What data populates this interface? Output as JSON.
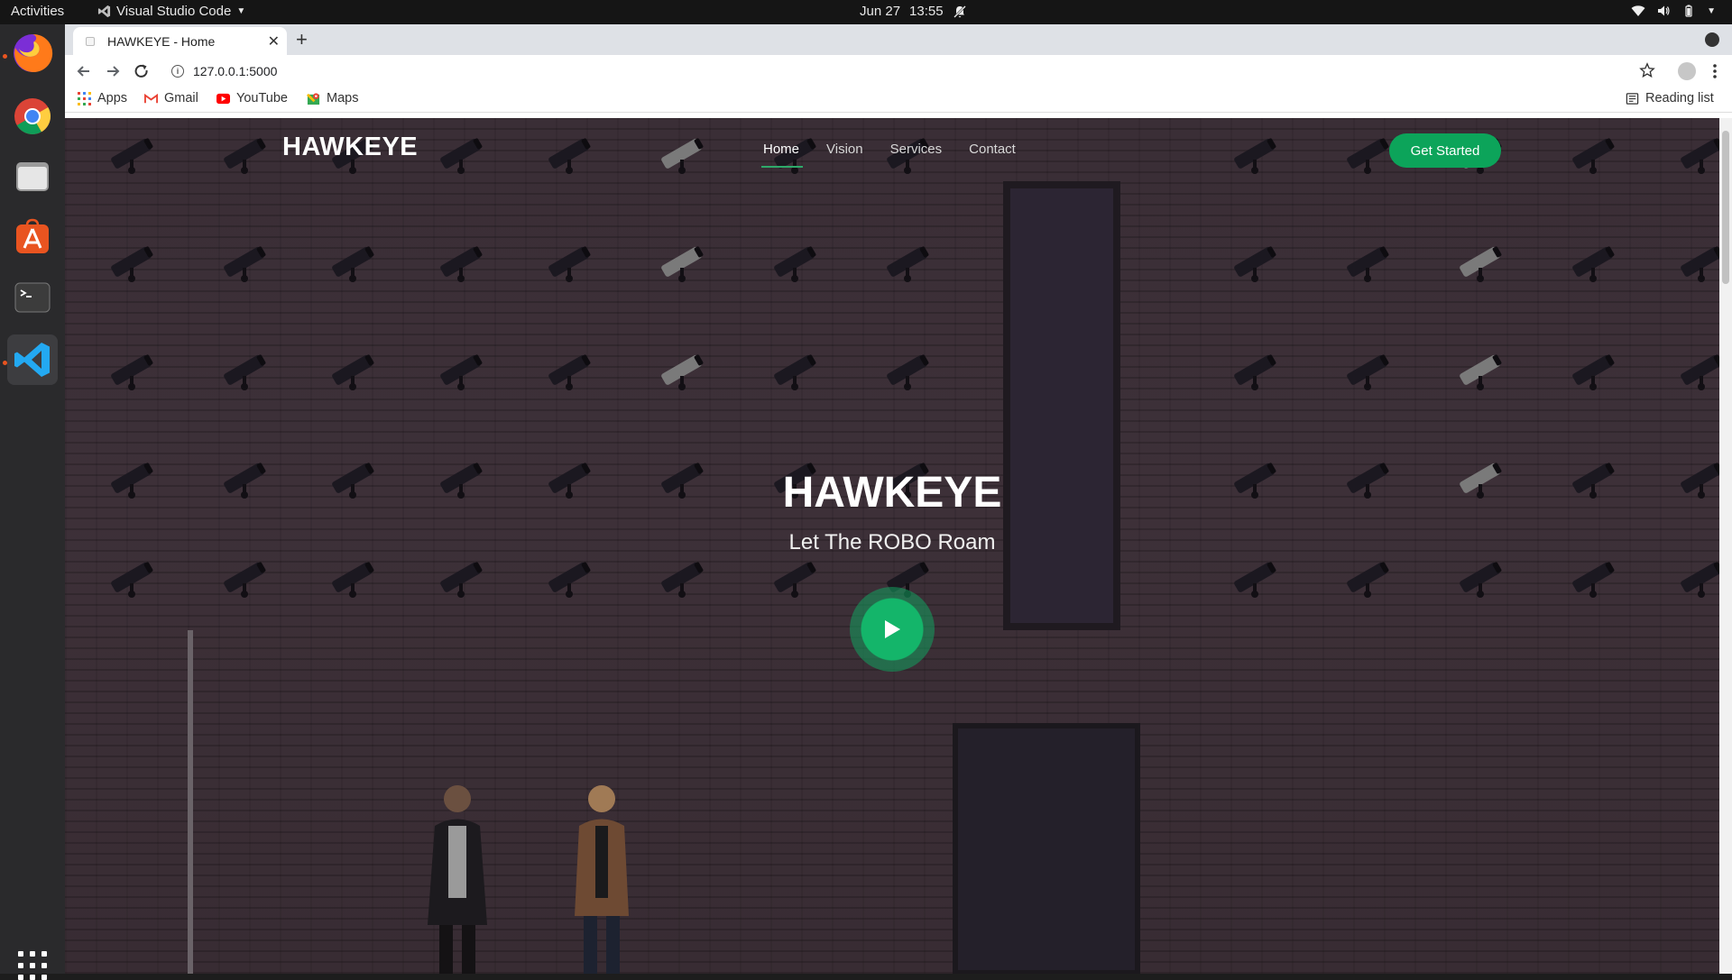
{
  "os": {
    "activities": "Activities",
    "app_name": "Visual Studio Code",
    "date": "Jun 27",
    "time": "13:55"
  },
  "dock": {
    "items": [
      "firefox-icon",
      "chrome-icon",
      "files-icon",
      "software-icon",
      "terminal-icon",
      "vscode-icon"
    ]
  },
  "browser": {
    "tab_title": "HAWKEYE - Home",
    "url": "127.0.0.1:5000",
    "bookmarks": [
      "Apps",
      "Gmail",
      "YouTube",
      "Maps"
    ],
    "reading_list": "Reading list"
  },
  "site": {
    "logo": "HAWKEYE",
    "nav": [
      "Home",
      "Vision",
      "Services",
      "Contact"
    ],
    "cta": "Get Started",
    "hero_title": "HAWKEYE",
    "hero_subtitle": "Let The ROBO Roam",
    "accent": "#0ca45a"
  }
}
